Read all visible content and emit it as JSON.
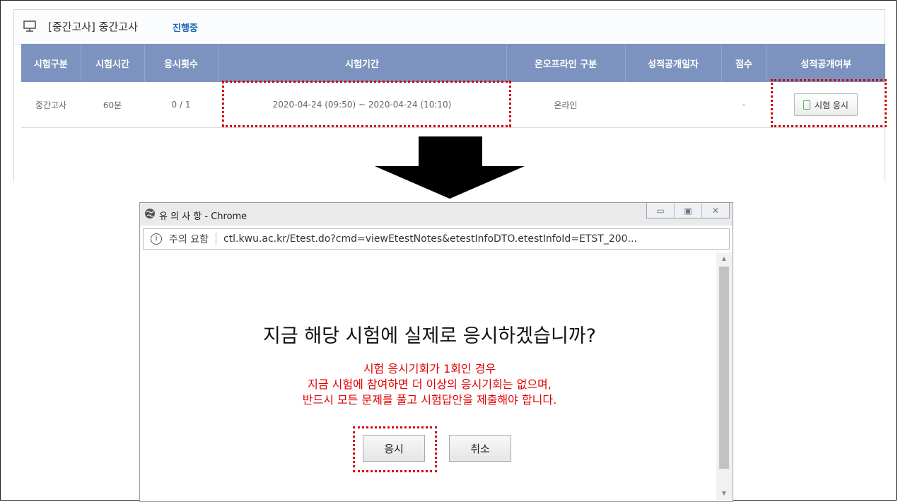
{
  "panel": {
    "title": "[중간고사] 중간고사",
    "status": "진행중",
    "icon": "monitor-icon"
  },
  "table": {
    "headers": [
      "시험구분",
      "시험시간",
      "응시횟수",
      "시험기간",
      "온오프라인 구분",
      "성적공개일자",
      "점수",
      "성적공개여부"
    ],
    "row": {
      "type": "중간고사",
      "duration": "60분",
      "attempts": "0 / 1",
      "period": "2020-04-24 (09:50) ~ 2020-04-24 (10:10)",
      "mode": "온라인",
      "release_date": "",
      "score": "-",
      "action_label": "시험 응시"
    }
  },
  "popup": {
    "window_title": "유 의 사 항 - Chrome",
    "security_label": "주의 요함",
    "url": "ctl.kwu.ac.kr/Etest.do?cmd=viewEtestNotes&etestInfoDTO.etestInfoId=ETST_200...",
    "question": "지금 해당 시험에 실제로 응시하겠습니까?",
    "warning_lines": [
      "시험 응시기회가 1회인 경우",
      "지금 시험에 참여하면 더 이상의 응시기회는 없으며,",
      "반드시 모든 문제를 풀고 시험답안을 제출해야 합니다."
    ],
    "confirm_label": "응시",
    "cancel_label": "취소"
  },
  "colors": {
    "table_header_bg": "#7d93bf",
    "status_blue": "#1d62b5",
    "warning_red": "#e00000",
    "highlight_dots": "#d40000"
  }
}
